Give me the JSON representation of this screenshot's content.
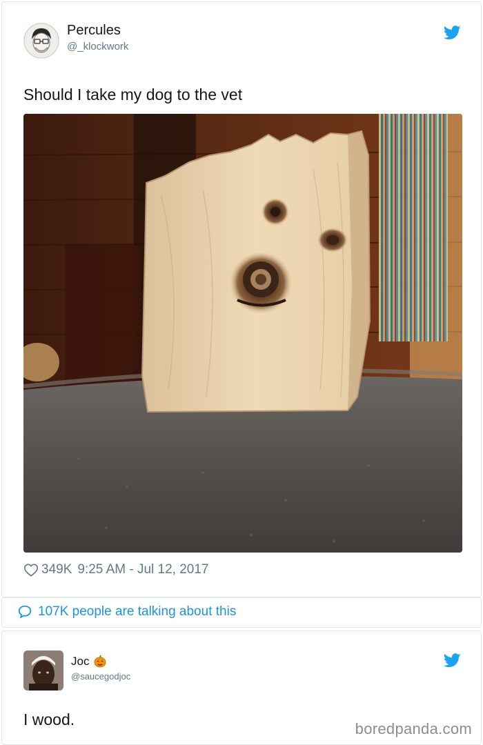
{
  "tweet1": {
    "name": "Percules",
    "handle": "@_klockwork",
    "text": "Should I take my dog to the vet",
    "likes": "349K",
    "timestamp": "9:25 AM - Jul 12, 2017"
  },
  "talk": {
    "text": "107K people are talking about this"
  },
  "tweet2": {
    "name": "Joc",
    "handle": "@saucegodjoc",
    "text": "I wood."
  },
  "watermark": "boredpanda.com",
  "colors": {
    "twitter_blue": "#1da1f2",
    "link_blue": "#1b95e0",
    "muted": "#657786"
  },
  "icons": [
    "twitter-bird-icon",
    "heart-icon",
    "speech-bubble-icon",
    "pumpkin-emoji-icon"
  ]
}
